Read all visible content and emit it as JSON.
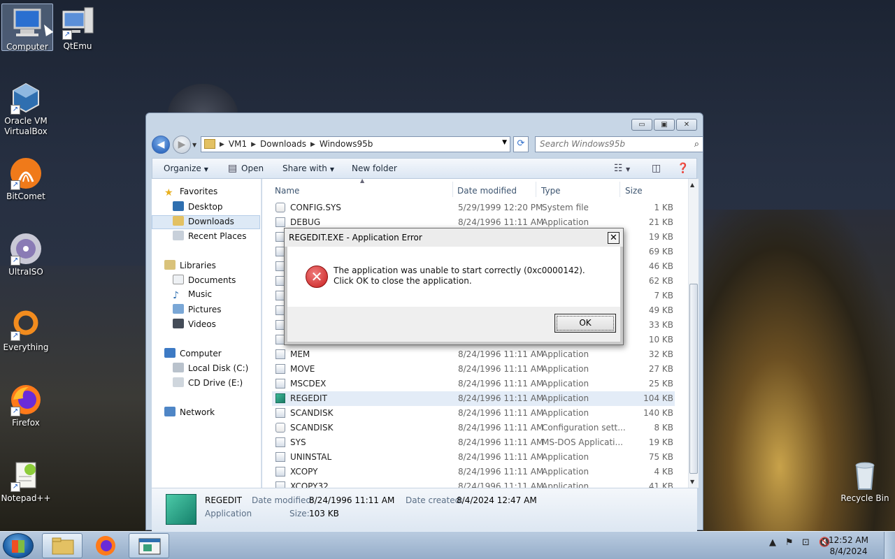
{
  "desktop": {
    "icons": [
      {
        "label": "Computer",
        "icon": "computer-icon"
      },
      {
        "label": "QtEmu",
        "icon": "qtemu-icon"
      },
      {
        "label": "Oracle VM VirtualBox",
        "icon": "virtualbox-icon"
      },
      {
        "label": "BitComet",
        "icon": "bitcomet-icon"
      },
      {
        "label": "UltraISO",
        "icon": "ultraiso-icon"
      },
      {
        "label": "Everything",
        "icon": "everything-icon"
      },
      {
        "label": "Firefox",
        "icon": "firefox-icon"
      },
      {
        "label": "Notepad++",
        "icon": "notepadpp-icon"
      },
      {
        "label": "Recycle Bin",
        "icon": "recycle-bin-icon"
      }
    ]
  },
  "explorer": {
    "breadcrumbs": [
      "VM1",
      "Downloads",
      "Windows95b"
    ],
    "search_placeholder": "Search Windows95b",
    "toolbar": {
      "organize": "Organize",
      "open": "Open",
      "share_with": "Share with",
      "new_folder": "New folder"
    },
    "nav": {
      "favorites": "Favorites",
      "desktop": "Desktop",
      "downloads": "Downloads",
      "recent_places": "Recent Places",
      "libraries": "Libraries",
      "documents": "Documents",
      "music": "Music",
      "pictures": "Pictures",
      "videos": "Videos",
      "computer": "Computer",
      "local_disk": "Local Disk (C:)",
      "cd_drive": "CD Drive (E:)",
      "network": "Network"
    },
    "columns": {
      "name": "Name",
      "date": "Date modified",
      "type": "Type",
      "size": "Size"
    },
    "files": [
      {
        "name": "CONFIG.SYS",
        "date": "5/29/1999 12:20 PM",
        "type": "System file",
        "size": "1 KB"
      },
      {
        "name": "DEBUG",
        "date": "8/24/1996 11:11 AM",
        "type": "Application",
        "size": "21 KB"
      },
      {
        "name": "",
        "date": "",
        "type": "",
        "size": "19 KB"
      },
      {
        "name": "",
        "date": "",
        "type": "",
        "size": "69 KB"
      },
      {
        "name": "",
        "date": "",
        "type": "",
        "size": "46 KB"
      },
      {
        "name": "",
        "date": "",
        "type": "",
        "size": "62 KB"
      },
      {
        "name": "",
        "date": "",
        "type": "",
        "size": "7 KB"
      },
      {
        "name": "",
        "date": "",
        "type": "",
        "size": "49 KB"
      },
      {
        "name": "",
        "date": "",
        "type": "",
        "size": "33 KB"
      },
      {
        "name": "",
        "date": "",
        "type": "",
        "size": "10 KB"
      },
      {
        "name": "MEM",
        "date": "8/24/1996 11:11 AM",
        "type": "Application",
        "size": "32 KB"
      },
      {
        "name": "MOVE",
        "date": "8/24/1996 11:11 AM",
        "type": "Application",
        "size": "27 KB"
      },
      {
        "name": "MSCDEX",
        "date": "8/24/1996 11:11 AM",
        "type": "Application",
        "size": "25 KB"
      },
      {
        "name": "REGEDIT",
        "date": "8/24/1996 11:11 AM",
        "type": "Application",
        "size": "104 KB"
      },
      {
        "name": "SCANDISK",
        "date": "8/24/1996 11:11 AM",
        "type": "Application",
        "size": "140 KB"
      },
      {
        "name": "SCANDISK",
        "date": "8/24/1996 11:11 AM",
        "type": "Configuration sett...",
        "size": "8 KB"
      },
      {
        "name": "SYS",
        "date": "8/24/1996 11:11 AM",
        "type": "MS-DOS Applicati...",
        "size": "19 KB"
      },
      {
        "name": "UNINSTAL",
        "date": "8/24/1996 11:11 AM",
        "type": "Application",
        "size": "75 KB"
      },
      {
        "name": "XCOPY",
        "date": "8/24/1996 11:11 AM",
        "type": "Application",
        "size": "4 KB"
      },
      {
        "name": "XCOPY32",
        "date": "8/24/1996 11:11 AM",
        "type": "Application",
        "size": "41 KB"
      }
    ],
    "details": {
      "name": "REGEDIT",
      "kind": "Application",
      "date_modified_label": "Date modified:",
      "date_modified": "8/24/1996 11:11 AM",
      "date_created_label": "Date created:",
      "date_created": "8/4/2024 12:47 AM",
      "size_label": "Size:",
      "size": "103 KB"
    }
  },
  "dialog": {
    "title": "REGEDIT.EXE - Application Error",
    "message": "The application was unable to start correctly (0xc0000142). Click OK to close the application.",
    "ok": "OK",
    "close": "✕"
  },
  "taskbar": {
    "time": "12:52 AM",
    "date": "8/4/2024"
  }
}
